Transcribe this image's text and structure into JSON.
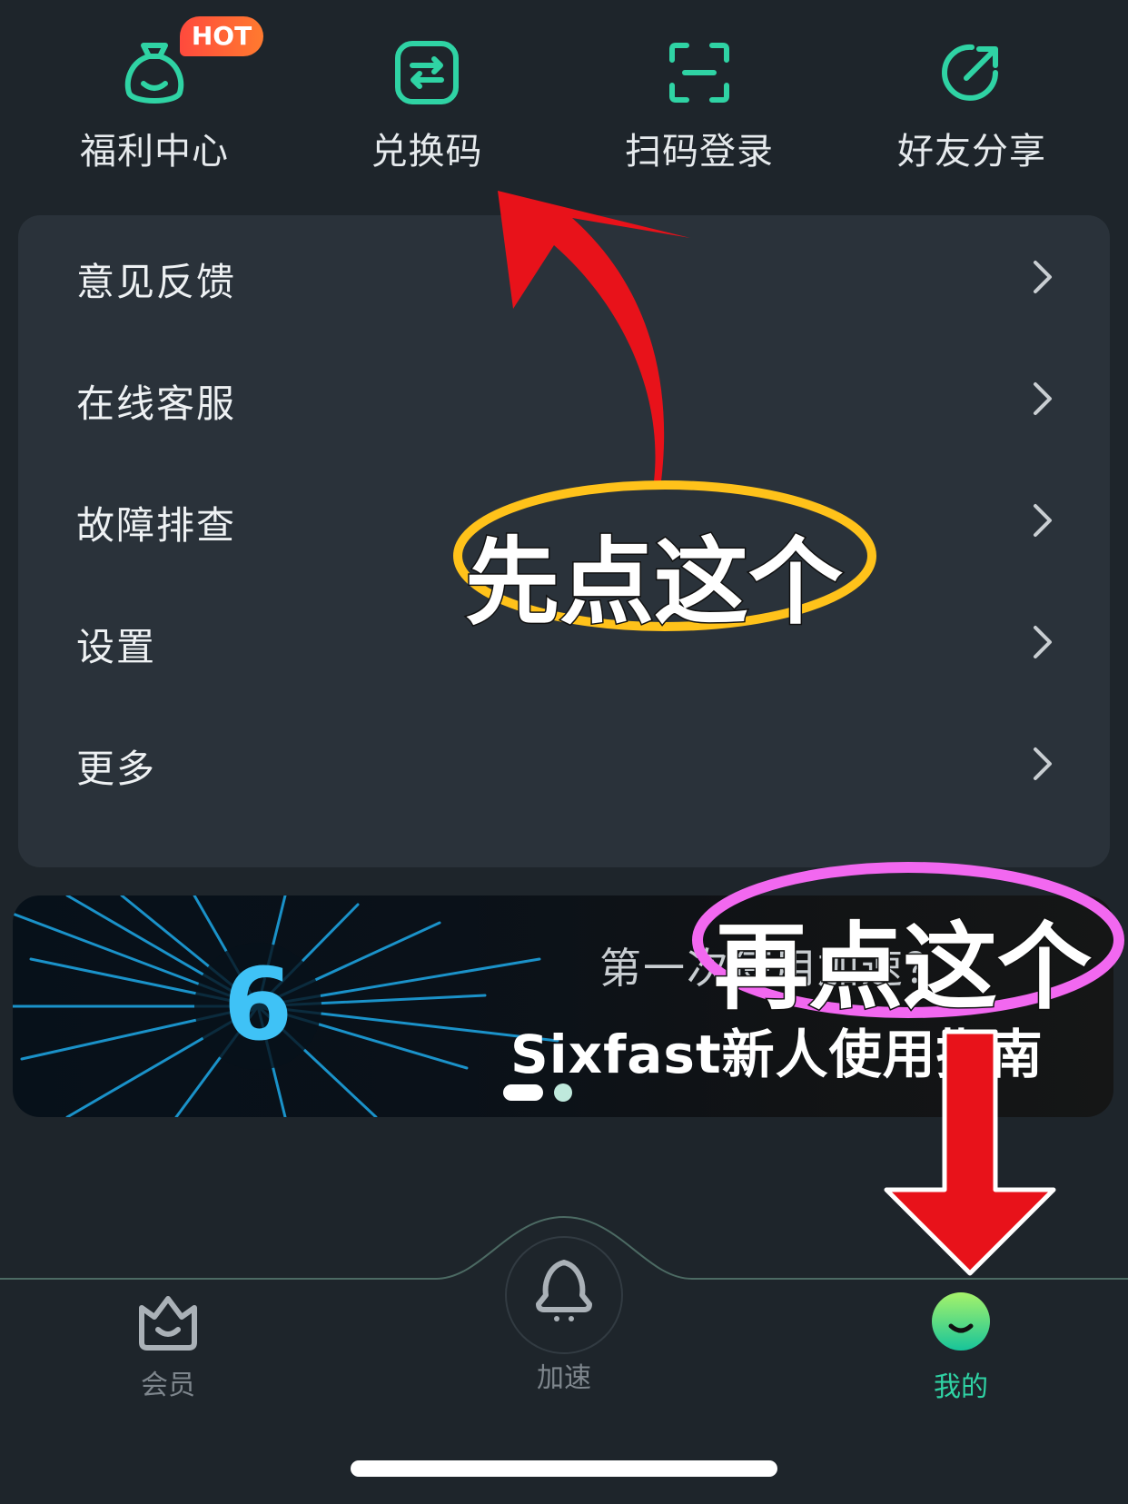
{
  "quick_actions": [
    {
      "label": "福利中心",
      "icon": "lucky-bag-icon",
      "badge": "HOT"
    },
    {
      "label": "兑换码",
      "icon": "exchange-code-icon"
    },
    {
      "label": "扫码登录",
      "icon": "scan-icon"
    },
    {
      "label": "好友分享",
      "icon": "share-icon"
    }
  ],
  "menu": {
    "items": [
      {
        "label": "意见反馈"
      },
      {
        "label": "在线客服"
      },
      {
        "label": "故障排查"
      },
      {
        "label": "设置"
      },
      {
        "label": "更多"
      }
    ]
  },
  "banner": {
    "subtitle": "第一次使用加速？",
    "title": "Sixfast新人使用指南",
    "logo": "6",
    "pager": {
      "current": 1,
      "total": 2
    }
  },
  "tab_bar": {
    "tabs": [
      {
        "label": "会员",
        "icon": "crown-icon",
        "active": false
      },
      {
        "label": "加速",
        "icon": "rocket-icon",
        "active": false
      },
      {
        "label": "我的",
        "icon": "profile-face-icon",
        "active": true
      }
    ]
  },
  "annotations": {
    "first": "先点这个",
    "second": "再点这个"
  },
  "colors": {
    "background": "#1e252b",
    "card": "#2a323a",
    "accent": "#2fd3a4",
    "hot_badge": "#ff4a3d",
    "annotation_red": "#e8121a",
    "annotation_yellow": "#ffc21a",
    "annotation_pink": "#f268f0"
  }
}
